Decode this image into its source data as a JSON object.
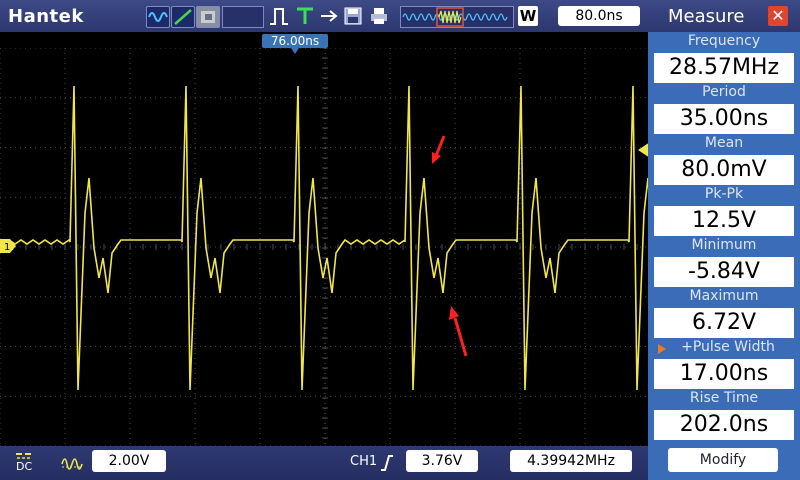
{
  "header": {
    "brand": "Hantek",
    "timebase": "80.0ns",
    "window_badge": "W",
    "trigger_position": "76.00ns"
  },
  "toolbar_icons": [
    "sine-wave-icon",
    "ramp-icon",
    "persistence-icon",
    "pulse-icon",
    "trigger-t-icon",
    "arrow-icon",
    "save-icon",
    "printer-icon",
    "memory-waveform-icon"
  ],
  "bottom": {
    "coupling": "DC",
    "ch1_volts_div": "2.00V",
    "channel": "CH1",
    "trigger_level": "3.76V",
    "trigger_freq": "4.39942MHz"
  },
  "measure": {
    "title": "Measure",
    "items": [
      {
        "label": "Frequency",
        "value": "28.57MHz"
      },
      {
        "label": "Period",
        "value": "35.00ns"
      },
      {
        "label": "Mean",
        "value": "80.0mV"
      },
      {
        "label": "Pk-Pk",
        "value": "12.5V"
      },
      {
        "label": "Minimum",
        "value": "-5.84V"
      },
      {
        "label": "Maximum",
        "value": "6.72V"
      },
      {
        "label": "+Pulse Width",
        "value": "17.00ns"
      },
      {
        "label": "Rise Time",
        "value": "202.0ns"
      }
    ],
    "modify_label": "Modify"
  },
  "channel_marker": "1",
  "colors": {
    "trace": "#f0e64a",
    "grid": "#5f5f5f",
    "panel": "#3b6cb8",
    "bar": "#2d376e",
    "arrow": "#ff2020"
  }
}
